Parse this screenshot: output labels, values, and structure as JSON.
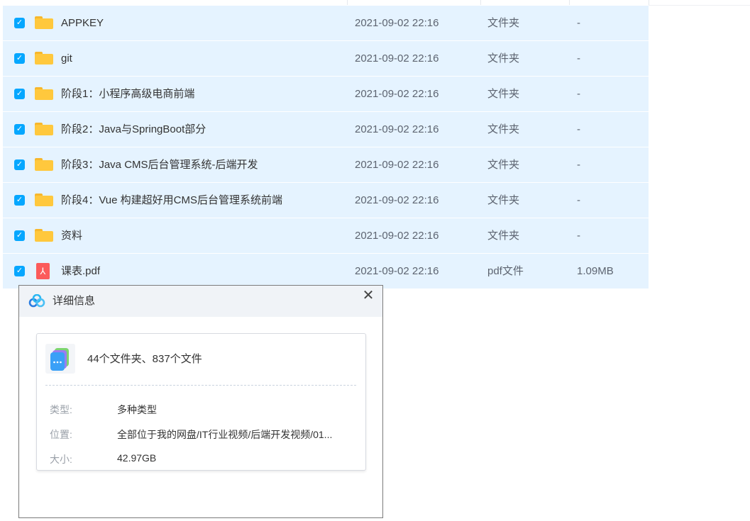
{
  "files": [
    {
      "name": "APPKEY",
      "date": "2021-09-02 22:16",
      "type": "文件夹",
      "size": "-",
      "icon": "folder-icon"
    },
    {
      "name": "git",
      "date": "2021-09-02 22:16",
      "type": "文件夹",
      "size": "-",
      "icon": "folder-icon"
    },
    {
      "name": "阶段1：小程序高级电商前端",
      "date": "2021-09-02 22:16",
      "type": "文件夹",
      "size": "-",
      "icon": "folder-icon"
    },
    {
      "name": "阶段2：Java与SpringBoot部分",
      "date": "2021-09-02 22:16",
      "type": "文件夹",
      "size": "-",
      "icon": "folder-icon"
    },
    {
      "name": "阶段3：Java CMS后台管理系统-后端开发",
      "date": "2021-09-02 22:16",
      "type": "文件夹",
      "size": "-",
      "icon": "folder-icon"
    },
    {
      "name": "阶段4：Vue 构建超好用CMS后台管理系统前端",
      "date": "2021-09-02 22:16",
      "type": "文件夹",
      "size": "-",
      "icon": "folder-icon"
    },
    {
      "name": "资料",
      "date": "2021-09-02 22:16",
      "type": "文件夹",
      "size": "-",
      "icon": "folder-icon"
    },
    {
      "name": "课表.pdf",
      "date": "2021-09-02 22:16",
      "type": "pdf文件",
      "size": "1.09MB",
      "icon": "pdf-icon"
    }
  ],
  "details": {
    "title": "详细信息",
    "summary": "44个文件夹、837个文件",
    "type_label": "类型:",
    "type_value": "多种类型",
    "location_label": "位置:",
    "location_value": "全部位于我的网盘/IT行业视频/后端开发视频/01...",
    "size_label": "大小:",
    "size_value": "42.97GB"
  },
  "colors": {
    "row_selected_bg": "#e5f3ff",
    "checkbox": "#06a7ff",
    "folder": "#ffc83d",
    "pdf": "#fb5b5b"
  }
}
